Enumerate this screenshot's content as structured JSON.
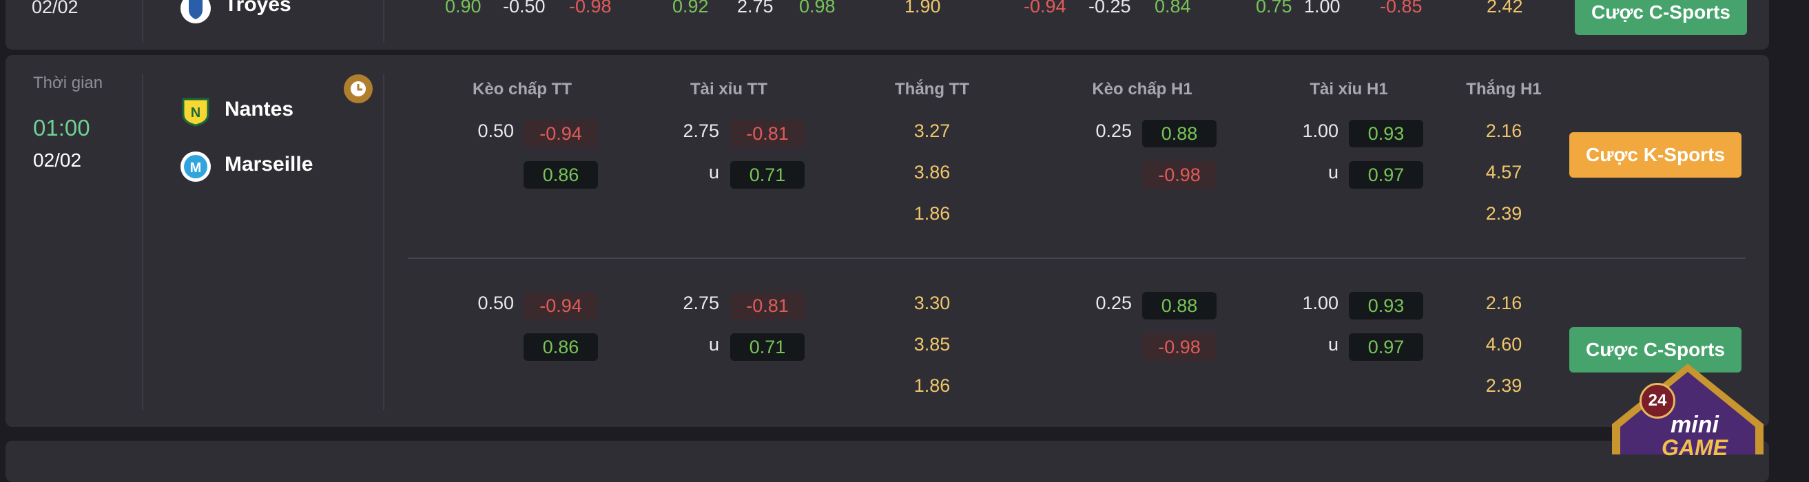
{
  "prev_match": {
    "date": "02/02",
    "team": "Troyes",
    "values": [
      "0.90",
      "-0.50",
      "-0.98",
      "0.92",
      "2.75",
      "0.98",
      "1.90",
      "-0.94",
      "-0.25",
      "0.84",
      "0.75",
      "1.00",
      "-0.85",
      "2.42"
    ],
    "button_label": "Cược C-Sports"
  },
  "match": {
    "time_label": "Thời gian",
    "time": "01:00",
    "date": "02/02",
    "home_team": "Nantes",
    "away_team": "Marseille",
    "headers": [
      "Kèo chấp TT",
      "Tài xỉu TT",
      "Thắng TT",
      "Kèo chấp H1",
      "Tài xỉu H1",
      "Thắng H1"
    ],
    "rows": [
      {
        "kc_tt_line": "0.50",
        "kc_tt_home": "-0.94",
        "kc_tt_away": "0.86",
        "tx_tt_line": "2.75",
        "tx_tt_over": "-0.81",
        "tx_tt_u": "u",
        "tx_tt_under": "0.71",
        "win_tt": [
          "3.27",
          "3.86",
          "1.86"
        ],
        "kc_h1_line": "0.25",
        "kc_h1_home": "0.88",
        "kc_h1_away": "-0.98",
        "tx_h1_line": "1.00",
        "tx_h1_over": "0.93",
        "tx_h1_u": "u",
        "tx_h1_under": "0.97",
        "win_h1": [
          "2.16",
          "4.57",
          "2.39"
        ],
        "button_label": "Cược K-Sports"
      },
      {
        "kc_tt_line": "0.50",
        "kc_tt_home": "-0.94",
        "kc_tt_away": "0.86",
        "tx_tt_line": "2.75",
        "tx_tt_over": "-0.81",
        "tx_tt_u": "u",
        "tx_tt_under": "0.71",
        "win_tt": [
          "3.30",
          "3.85",
          "1.86"
        ],
        "kc_h1_line": "0.25",
        "kc_h1_home": "0.88",
        "kc_h1_away": "-0.98",
        "tx_h1_line": "1.00",
        "tx_h1_over": "0.93",
        "tx_h1_u": "u",
        "tx_h1_under": "0.97",
        "win_h1": [
          "2.16",
          "4.60",
          "2.39"
        ],
        "button_label": "Cược C-Sports"
      }
    ]
  },
  "mini_game": {
    "badge": "24",
    "line1": "mini",
    "line2": "GAME"
  },
  "colors": {
    "green": "#77c558",
    "red": "#e25b59",
    "gold": "#f0c66b",
    "c_sports": "#46a36b",
    "k_sports": "#f0a83f"
  }
}
